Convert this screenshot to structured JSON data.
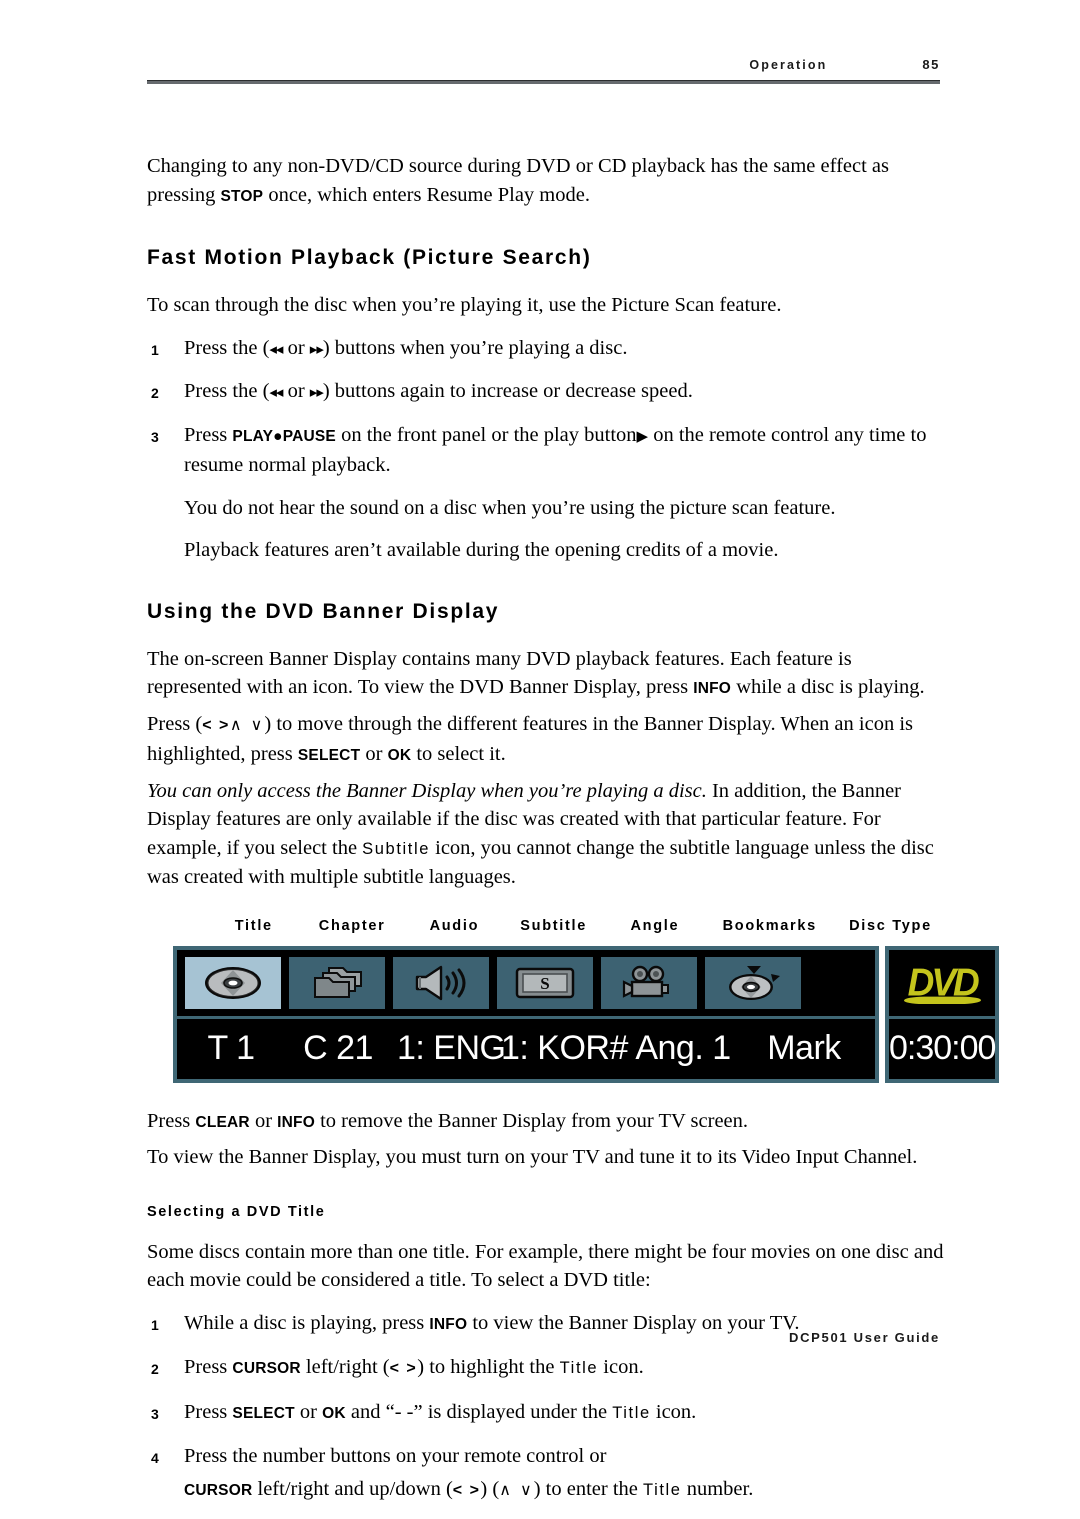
{
  "header": {
    "section": "Operation",
    "page_number": "85"
  },
  "footer": {
    "guide": "DCP501 User Guide"
  },
  "intro": {
    "part1": "Changing to any non-DVD/CD source during DVD or CD playback has the same effect as pressing ",
    "stop_key": "STOP",
    "part2": " once, which enters Resume Play mode."
  },
  "section1": {
    "heading": "Fast Motion Playback (Picture Search)",
    "lead": "To scan through the disc when you’re playing it, use the Picture Scan feature.",
    "steps": [
      {
        "num": "1",
        "pre": "Press the (",
        "rew": "◂◂",
        "mid": " or ",
        "ffwd": "▸▸",
        "post": ") buttons when you’re playing a disc."
      },
      {
        "num": "2",
        "pre": "Press the (",
        "rew": "◂◂",
        "mid": " or ",
        "ffwd": "▸▸",
        "post": ") buttons again to increase or decrease speed."
      }
    ],
    "step3": {
      "num": "3",
      "pre": "Press ",
      "key": "PLAY●PAUSE",
      "mid": " on the front panel or the play button",
      "play_glyph": "▶",
      "post": " on the remote control any time to resume normal playback."
    },
    "note1": "You do not hear the sound on a disc when you’re using the picture scan feature.",
    "note2": "Playback features aren’t available during the opening credits of a movie."
  },
  "section2": {
    "heading": "Using the DVD Banner Display",
    "para1_a": "The on-screen Banner Display contains many DVD playback features. Each feature is represented with an icon. To view the DVD Banner Display, press ",
    "para1_key": "INFO",
    "para1_b": " while a disc is playing.",
    "para2_a": "Press (",
    "para2_cursor": "< >",
    "para2_updown": "∧ ∨",
    "para2_b": ") to move through the different features in the Banner Display. When an icon is highlighted, press ",
    "para2_key1": "SELECT",
    "para2_c": " or ",
    "para2_key2": "OK",
    "para2_d": " to select it.",
    "para3_italic": "You can only access the Banner Display when you’re playing a disc.",
    "para3_a": " In addition, the Banner Display features are only available if the disc was created with that particular feature. For example, if you select the ",
    "para3_mono": "Subtitle",
    "para3_b": " icon, you cannot change the subtitle language unless the disc was created with multiple subtitle languages.",
    "after_a": "Press ",
    "after_key1": "CLEAR",
    "after_b": " or ",
    "after_key2": "INFO",
    "after_c": " to remove the Banner Display from your TV screen.",
    "after_para2": "To view the Banner Display, you must turn on your TV and tune it to its Video Input Channel."
  },
  "banner": {
    "labels": [
      "Title",
      "Chapter",
      "Audio",
      "Subtitle",
      "Angle",
      "Bookmarks",
      "Disc Type"
    ],
    "icons": [
      {
        "name": "disc-icon",
        "selected": true
      },
      {
        "name": "chapter-folders-icon",
        "selected": false
      },
      {
        "name": "speaker-icon",
        "selected": false
      },
      {
        "name": "subtitle-s-icon",
        "selected": false
      },
      {
        "name": "camera-angle-icon",
        "selected": false
      },
      {
        "name": "bookmark-disc-icon",
        "selected": false
      }
    ],
    "fields": {
      "title": "T  1",
      "chapter": "C  21",
      "audio": "1: ENG",
      "subtitle": "1: KOR#",
      "angle": "Ang. 1",
      "bookmark": "Mark"
    },
    "disc_type_logo": "DVD",
    "time": "0:30:00",
    "colors": {
      "panel_bg": "#000000",
      "border": "#3f6775",
      "cell_bg": "#3d6272",
      "cell_selected_bg": "#a6c3d3",
      "logo_yellow": "#c4c41c",
      "text": "#ffffff"
    }
  },
  "section3": {
    "heading": "Selecting a DVD Title",
    "para": "Some discs contain more than one title. For example, there might be four movies on one disc and each movie could be considered a title. To select a DVD title:",
    "step1": {
      "num": "1",
      "pre": "While a disc is playing, press ",
      "key": "INFO",
      "post": " to view the Banner Display on your TV."
    },
    "step2": {
      "num": "2",
      "pre": "Press ",
      "key": "CURSOR",
      "mid": " left/right (",
      "glyph": "< >",
      "mid2": ") to highlight the ",
      "mono": "Title",
      "post": " icon."
    },
    "step3": {
      "num": "3",
      "pre": "Press ",
      "key1": "SELECT",
      "mid": " or ",
      "key2": "OK",
      "mid2": " and “- -” is displayed under the ",
      "mono": "Title",
      "post": " icon."
    },
    "step4": {
      "num": "4",
      "text": "Press the number buttons on your remote control or",
      "cont_key": "CURSOR",
      "cont_a": " left/right and up/down (",
      "cont_glyph1": "< >",
      "cont_b": ") (",
      "cont_glyph2": "∧ ∨",
      "cont_c": ") to enter the ",
      "cont_mono": "Title",
      "cont_d": " number."
    }
  }
}
